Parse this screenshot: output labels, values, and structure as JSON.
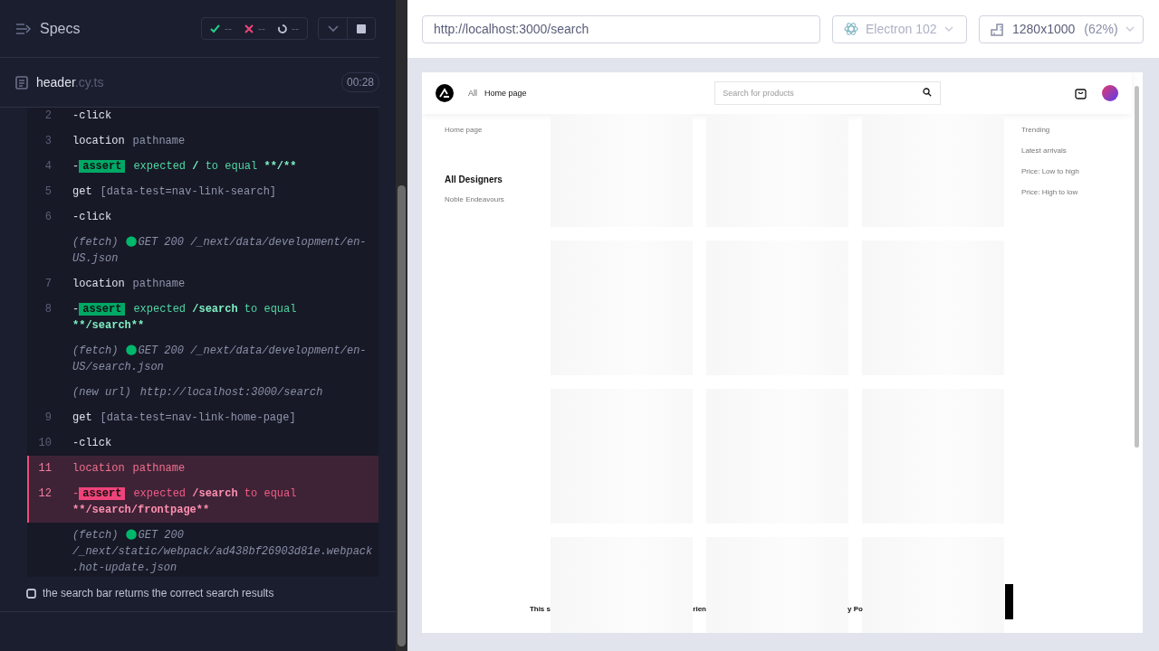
{
  "reporter": {
    "title": "Specs",
    "stats": [
      {
        "kind": "passed",
        "count": "--"
      },
      {
        "kind": "failed",
        "count": "--"
      },
      {
        "kind": "pending",
        "count": "--"
      }
    ]
  },
  "spec": {
    "name": "header",
    "extension": ".cy.ts",
    "duration": "00:28"
  },
  "commands": [
    {
      "kind": "command",
      "number": "2",
      "name": "-click",
      "failed": false
    },
    {
      "kind": "command",
      "number": "3",
      "name": "location",
      "message": "pathname",
      "failed": false
    },
    {
      "kind": "assert",
      "number": "4",
      "prefix": "-",
      "badge": "assert",
      "message": [
        "expected",
        "/",
        "to equal",
        "**/**"
      ],
      "failed": false
    },
    {
      "kind": "command",
      "number": "5",
      "name": "get",
      "message": "[data-test=nav-link-search]",
      "failed": false
    },
    {
      "kind": "command",
      "number": "6",
      "name": "-click",
      "failed": false
    },
    {
      "kind": "event",
      "label": "(fetch)",
      "icon": "●",
      "message": "GET 200 /_next/data/development/en-US.json"
    },
    {
      "kind": "command",
      "number": "7",
      "name": "location",
      "message": "pathname",
      "failed": false
    },
    {
      "kind": "assert",
      "number": "8",
      "prefix": "-",
      "badge": "assert",
      "message": [
        "expected",
        "/search",
        "to equal",
        "**/search**"
      ],
      "failed": false
    },
    {
      "kind": "event",
      "label": "(fetch)",
      "icon": "●",
      "message": "GET 200 /_next/data/development/en-US/search.json"
    },
    {
      "kind": "event",
      "label": "(new url)",
      "message": "http://localhost:3000/search"
    },
    {
      "kind": "command",
      "number": "9",
      "name": "get",
      "message": "[data-test=nav-link-home-page]",
      "failed": false
    },
    {
      "kind": "command",
      "number": "10",
      "name": "-click",
      "failed": false
    },
    {
      "kind": "command",
      "number": "11",
      "name": "location",
      "message": "pathname",
      "failed": true
    },
    {
      "kind": "assert",
      "number": "12",
      "prefix": "-",
      "badge": "assert",
      "message": [
        "expected",
        "/search",
        "to equal",
        "**/search/frontpage**"
      ],
      "failed": true
    },
    {
      "kind": "event",
      "label": "(fetch)",
      "icon": "●",
      "message": "GET 200 /_next/static/webpack/ad438bf26903d81e.webpack.hot-update.json"
    }
  ],
  "test": {
    "title": "the search bar returns the correct search results",
    "checked": false
  },
  "toolbar": {
    "url": "http://localhost:3000/search",
    "browser": "Electron 102",
    "viewport": "1280x1000",
    "scale": "(62%)"
  },
  "app": {
    "nav": [
      {
        "label": "All",
        "selected": false
      },
      {
        "label": "Home page",
        "selected": true
      }
    ],
    "search_placeholder": "Search for products",
    "breadcrumb": "Home page",
    "filter_heading": "All Designers",
    "designers": [
      "Noble Endeavours"
    ],
    "sort_options": [
      "Trending",
      "Latest arrivals",
      "Price: Low to high",
      "Price: High to low"
    ],
    "footer_fragments": [
      "This s",
      "rien",
      "y Po"
    ]
  }
}
